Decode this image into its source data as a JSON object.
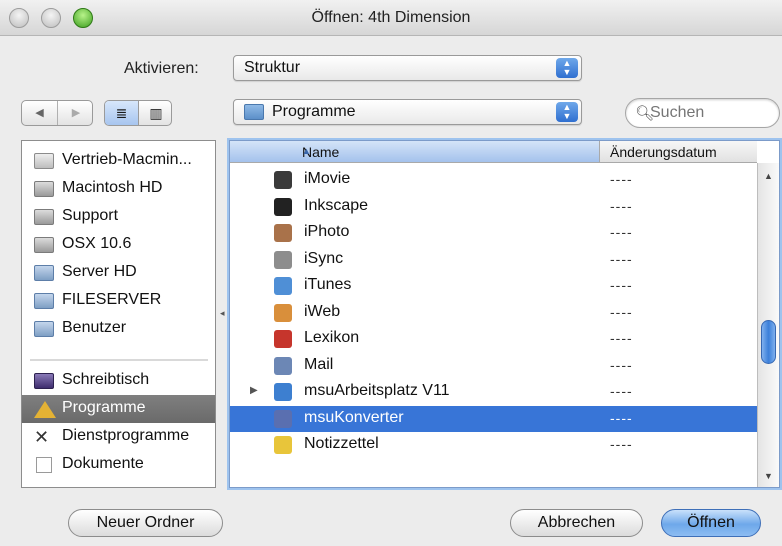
{
  "window": {
    "title": "Öffnen: 4th Dimension"
  },
  "activate": {
    "label": "Aktivieren:",
    "value": "Struktur"
  },
  "location": {
    "value": "Programme"
  },
  "search": {
    "placeholder": "Suchen"
  },
  "sidebar": {
    "items": [
      {
        "label": "Vertrieb-Macmin...",
        "icon": "network-computer-icon"
      },
      {
        "label": "Macintosh HD",
        "icon": "hard-disk-icon"
      },
      {
        "label": "Support",
        "icon": "hard-disk-icon"
      },
      {
        "label": "OSX 10.6",
        "icon": "hard-disk-icon"
      },
      {
        "label": "Server HD",
        "icon": "server-icon"
      },
      {
        "label": "FILESERVER",
        "icon": "server-icon"
      },
      {
        "label": "Benutzer",
        "icon": "server-icon"
      }
    ],
    "places": [
      {
        "label": "Schreibtisch",
        "icon": "desktop-icon",
        "selected": false
      },
      {
        "label": "Programme",
        "icon": "applications-icon",
        "selected": true
      },
      {
        "label": "Dienstprogramme",
        "icon": "utilities-icon",
        "selected": false
      },
      {
        "label": "Dokumente",
        "icon": "documents-icon",
        "selected": false
      }
    ]
  },
  "files": {
    "columns": {
      "name": "Name",
      "date": "Änderungsdatum"
    },
    "rows": [
      {
        "name": "iMovie",
        "date": "----",
        "icon": "imovie-icon",
        "color": "#3a3a3a"
      },
      {
        "name": "Inkscape",
        "date": "----",
        "icon": "inkscape-icon",
        "color": "#222222"
      },
      {
        "name": "iPhoto",
        "date": "----",
        "icon": "iphoto-icon",
        "color": "#a9724a"
      },
      {
        "name": "iSync",
        "date": "----",
        "icon": "isync-icon",
        "color": "#8d8d8d"
      },
      {
        "name": "iTunes",
        "date": "----",
        "icon": "itunes-icon",
        "color": "#4f8fd6"
      },
      {
        "name": "iWeb",
        "date": "----",
        "icon": "iweb-icon",
        "color": "#d98f3b"
      },
      {
        "name": "Lexikon",
        "date": "----",
        "icon": "lexikon-icon",
        "color": "#c6352c"
      },
      {
        "name": "Mail",
        "date": "----",
        "icon": "mail-icon",
        "color": "#6c87b5"
      },
      {
        "name": "msuArbeitsplatz V11",
        "date": "----",
        "icon": "folder-icon",
        "color": "#3d7fd0",
        "expandable": true
      },
      {
        "name": "msuKonverter",
        "date": "----",
        "icon": "msukonverter-icon",
        "color": "#5a6fb0",
        "selected": true
      },
      {
        "name": "Notizzettel",
        "date": "----",
        "icon": "notes-icon",
        "color": "#e8c53a"
      }
    ]
  },
  "buttons": {
    "new_folder": "Neuer Ordner",
    "cancel": "Abbrechen",
    "open": "Öffnen"
  }
}
